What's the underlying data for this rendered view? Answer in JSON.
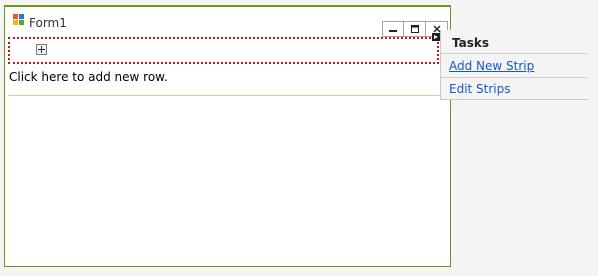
{
  "form": {
    "title": "Form1",
    "add_row_text": "Click here to add new row."
  },
  "window_controls": {
    "minimize_icon": "minimize-icon",
    "maximize_icon": "maximize-icon",
    "close_icon": "close-icon"
  },
  "tasks_panel": {
    "header": "Tasks",
    "items": [
      {
        "label": "Add New Strip"
      },
      {
        "label": "Edit Strips"
      }
    ]
  },
  "colors": {
    "window_border": "#6f8f1d",
    "strip_dotted_border": "#c21a1a",
    "link": "#1b57c7"
  }
}
